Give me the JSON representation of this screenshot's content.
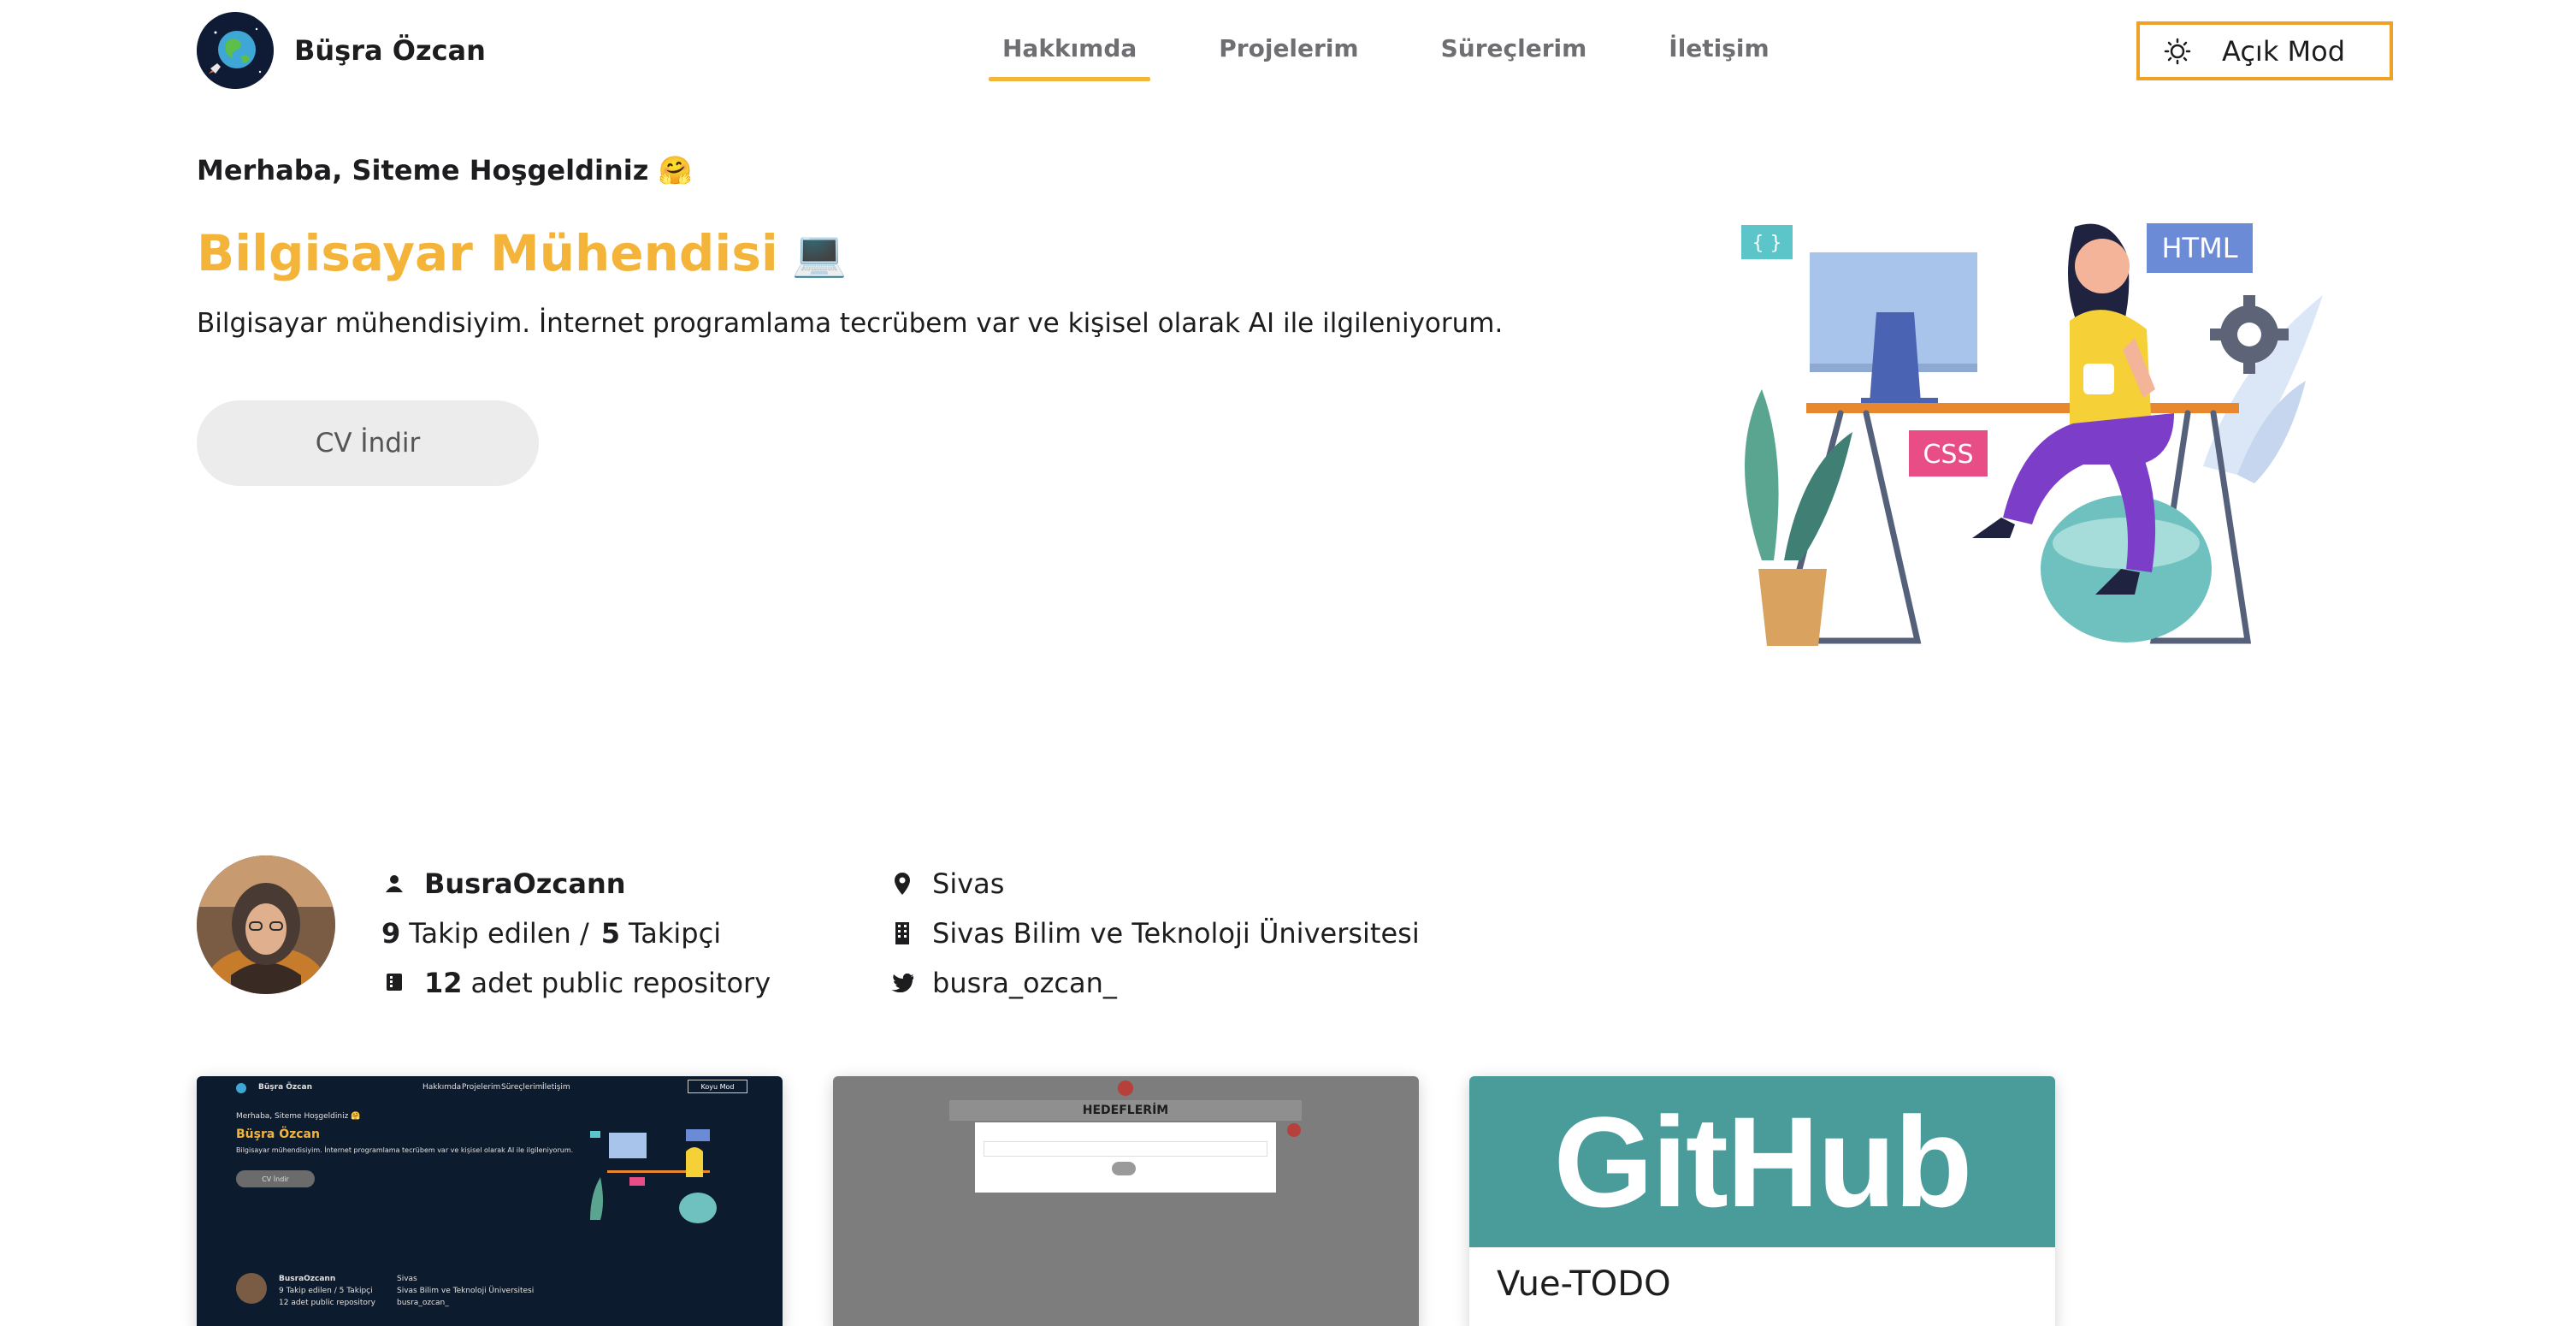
{
  "header": {
    "brand_name": "Büşra Özcan",
    "nav": [
      "Hakkımda",
      "Projelerim",
      "Süreçlerim",
      "İletişim"
    ],
    "active_nav": "Hakkımda",
    "mode_button": "Açık Mod"
  },
  "hero": {
    "greeting": "Merhaba, Siteme Hoşgeldiniz 🤗",
    "title": "Bilgisayar Mühendisi",
    "title_emoji": "💻",
    "description": "Bilgisayar mühendisiyim. İnternet programlama tecrübem var ve kişisel olarak AI ile ilgileniyorum.",
    "cv_button": "CV İndir",
    "illustration_labels": {
      "braces": "{ }",
      "html": "HTML",
      "css": "CSS"
    }
  },
  "profile": {
    "username": "BusraOzcann",
    "following_count": "9",
    "following_label": "Takip edilen /",
    "followers_count": "5",
    "followers_label": "Takipçi",
    "repo_count": "12",
    "repo_label": "adet public repository",
    "location": "Sivas",
    "organization": "Sivas Bilim ve Teknoloji Üniversitesi",
    "twitter": "busra_ozcan_"
  },
  "cards": {
    "card1": {
      "brand": "Büşra Özcan",
      "nav": [
        "Hakkımda",
        "Projelerim",
        "Süreçlerim",
        "İletişim"
      ],
      "mode": "Koyu Mod",
      "greeting": "Merhaba, Siteme Hoşgeldiniz 🤗",
      "title": "Büşra Özcan",
      "desc": "Bilgisayar mühendisiyim. İnternet programlama tecrübem var ve kişisel olarak AI ile ilgileniyorum.",
      "cv": "CV İndir",
      "username": "BusraOzcann",
      "follow": "9 Takip edilen / 5 Takipçi",
      "repos": "12 adet public repository",
      "loc": "Sivas",
      "org": "Sivas Bilim ve Teknoloji Üniversitesi",
      "tw": "busra_ozcan_"
    },
    "card2": {
      "heading": "HEDEFLERİM"
    },
    "card3": {
      "banner": "GitHub",
      "title": "Vue-TODO"
    }
  },
  "colors": {
    "accent": "#f4b43a",
    "mode_border": "#f0a126",
    "github_banner": "#4a9c9b"
  }
}
